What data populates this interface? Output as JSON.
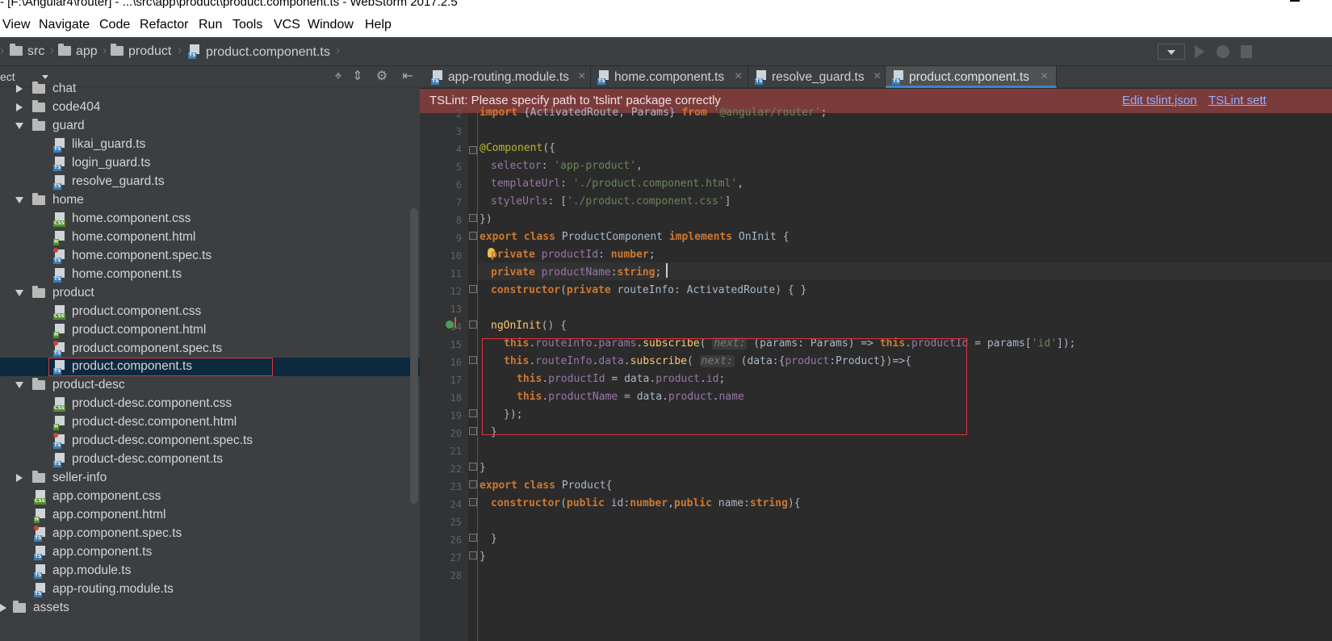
{
  "window": {
    "title": "- [F:\\Angular4\\router] - ...\\src\\app\\product\\product.component.ts - WebStorm 2017.2.5"
  },
  "menu": [
    "View",
    "Navigate",
    "Code",
    "Refactor",
    "Run",
    "Tools",
    "VCS",
    "Window",
    "Help"
  ],
  "breadcrumb": [
    "src",
    "app",
    "product",
    "product.component.ts"
  ],
  "project": {
    "label": "ect",
    "tree": [
      {
        "label": "chat"
      },
      {
        "label": "code404"
      },
      {
        "label": "guard"
      },
      {
        "label": "likai_guard.ts"
      },
      {
        "label": "login_guard.ts"
      },
      {
        "label": "resolve_guard.ts"
      },
      {
        "label": "home"
      },
      {
        "label": "home.component.css"
      },
      {
        "label": "home.component.html"
      },
      {
        "label": "home.component.spec.ts"
      },
      {
        "label": "home.component.ts"
      },
      {
        "label": "product"
      },
      {
        "label": "product.component.css"
      },
      {
        "label": "product.component.html"
      },
      {
        "label": "product.component.spec.ts"
      },
      {
        "label": "product.component.ts"
      },
      {
        "label": "product-desc"
      },
      {
        "label": "product-desc.component.css"
      },
      {
        "label": "product-desc.component.html"
      },
      {
        "label": "product-desc.component.spec.ts"
      },
      {
        "label": "product-desc.component.ts"
      },
      {
        "label": "seller-info"
      },
      {
        "label": "app.component.css"
      },
      {
        "label": "app.component.html"
      },
      {
        "label": "app.component.spec.ts"
      },
      {
        "label": "app.component.ts"
      },
      {
        "label": "app.module.ts"
      },
      {
        "label": "app-routing.module.ts"
      },
      {
        "label": "assets"
      }
    ]
  },
  "tabs": [
    {
      "label": "app-routing.module.ts"
    },
    {
      "label": "home.component.ts"
    },
    {
      "label": "resolve_guard.ts"
    },
    {
      "label": "product.component.ts"
    }
  ],
  "lint": {
    "message": "TSLint: Please specify path to 'tslint' package correctly",
    "edit_link": "Edit tslint.json",
    "settings_link": "TSLint sett"
  },
  "editor": {
    "line_numbers": [
      "2",
      "3",
      "4",
      "5",
      "6",
      "7",
      "8",
      "9",
      "10",
      "11",
      "12",
      "13",
      "14",
      "15",
      "16",
      "17",
      "18",
      "19",
      "20",
      "21",
      "22",
      "23",
      "24",
      "25",
      "26",
      "27",
      "28"
    ],
    "hint_next": "next:"
  },
  "colors": {
    "keyword": "#cc7832",
    "string": "#6a8759",
    "property": "#9876aa",
    "function": "#ffc66d",
    "lint_bar": "#7b3b3b",
    "highlight_box": "#d9353b",
    "selection": "#0d293e"
  }
}
